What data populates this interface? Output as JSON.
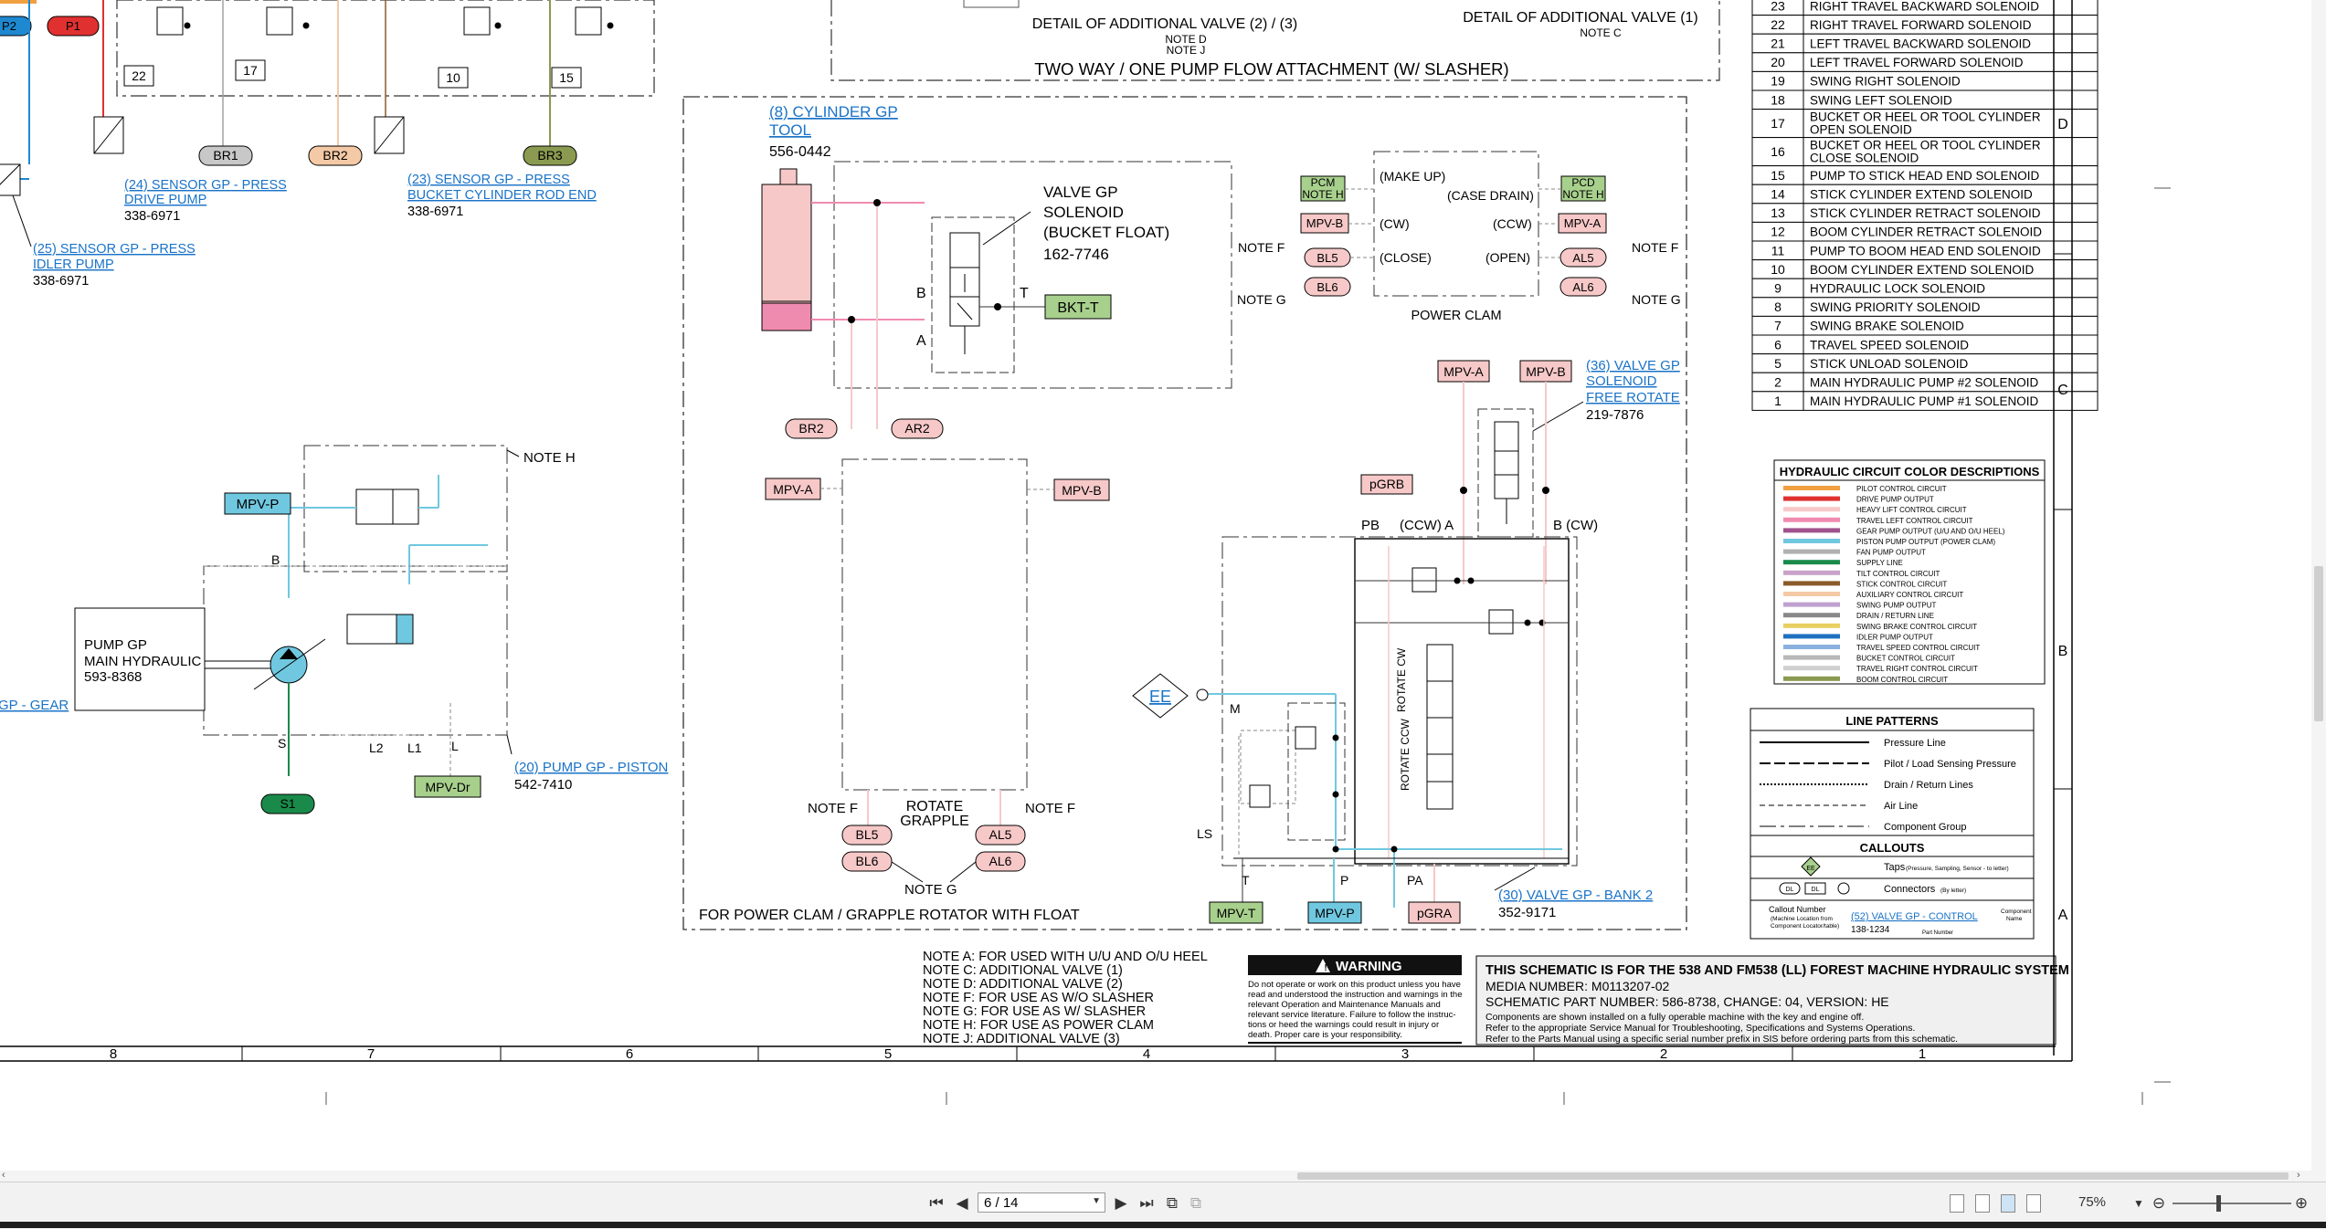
{
  "viewer": {
    "page_indicator": "6 / 14",
    "zoom": "75%"
  },
  "top_tags": {
    "p2": "P2",
    "p1": "P1"
  },
  "detail": {
    "two_three": "DETAIL OF ADDITIONAL VALVE (2) / (3)",
    "note_d": "NOTE D",
    "note_j": "NOTE J",
    "one": "DETAIL OF ADDITIONAL VALVE (1)",
    "note_c": "NOTE C",
    "box_title": "TWO WAY / ONE PUMP FLOW  ATTACHMENT (W/ SLASHER)",
    "valve_nums": [
      "22",
      "17",
      "10",
      "15"
    ]
  },
  "sensors": {
    "s24_line1": "(24) SENSOR GP - PRESS",
    "s24_line2": "DRIVE PUMP",
    "s24_part": "338-6971",
    "s23_line1": "(23) SENSOR GP - PRESS",
    "s23_line2": "BUCKET CYLINDER ROD END",
    "s23_part": "338-6971",
    "s25_line1": "(25) SENSOR GP - PRESS",
    "s25_line2": "IDLER PUMP",
    "s25_part": "338-6971",
    "br1": "BR1",
    "br2": "BR2",
    "br3": "BR3"
  },
  "pump": {
    "mpv_p": "MPV-P",
    "note_h": "NOTE H",
    "label_l1": "PUMP GP",
    "label_l2": "MAIN HYDRAULIC",
    "label_part": "593-8368",
    "port_b": "B",
    "port_s": "S",
    "port_l2": "L2",
    "port_l1": "L1",
    "port_l": "L",
    "s1": "S1",
    "mpv_dr": "MPV-Dr",
    "gear_link": "GP - GEAR",
    "piston_link": "(20) PUMP GP - PISTON",
    "piston_part": "542-7410"
  },
  "attachment": {
    "cyl_link_l1": "(8) CYLINDER GP",
    "cyl_link_l2": "TOOL",
    "cyl_part": "556-0442",
    "valve_l1": "VALVE GP",
    "valve_l2": "SOLENOID",
    "valve_l3": "(BUCKET FLOAT)",
    "valve_part": "162-7746",
    "port_b": "B",
    "port_a": "A",
    "port_t": "T",
    "bkt_t": "BKT-T",
    "br2": "BR2",
    "ar2": "AR2",
    "mpv_a": "MPV-A",
    "mpv_b": "MPV-B",
    "rotate_l1": "ROTATE",
    "rotate_l2": "GRAPPLE",
    "note_f_left": "NOTE F",
    "note_f_right": "NOTE F",
    "note_g": "NOTE G",
    "bl5": "BL5",
    "bl6": "BL6",
    "al5": "AL5",
    "al6": "AL6",
    "footer": "FOR POWER CLAM / GRAPPLE ROTATOR WITH FLOAT"
  },
  "clam": {
    "pcm_l1": "PCM",
    "pcm_l2": "NOTE H",
    "pcd_l1": "PCD",
    "pcd_l2": "NOTE H",
    "make_up": "(MAKE UP)",
    "case_drain": "(CASE DRAIN)",
    "cw": "(CW)",
    "ccw": "(CCW)",
    "close": "(CLOSE)",
    "open": "(OPEN)",
    "mpv_b": "MPV-B",
    "mpv_a": "MPV-A",
    "bl5": "BL5",
    "bl6": "BL6",
    "al5": "AL5",
    "al6": "AL6",
    "note_f_l": "NOTE F",
    "note_g_l": "NOTE G",
    "note_f_r": "NOTE F",
    "note_g_r": "NOTE G",
    "title": "POWER CLAM"
  },
  "free_rotate": {
    "mpv_a": "MPV-A",
    "mpv_b": "MPV-B",
    "link_l1": "(36) VALVE GP",
    "link_l2": "SOLENOID",
    "link_l3": "FREE ROTATE",
    "part": "219-7876",
    "pgrb": "pGRB",
    "pb": "PB",
    "ccw_a": "(CCW) A",
    "b_cw": "B (CW)",
    "ee": "EE",
    "m": "M",
    "ls": "LS",
    "t": "T",
    "p": "P",
    "pa": "PA",
    "rotate_cw": "ROTATE CW",
    "rotate_ccw": "ROTATE CCW",
    "mpv_t": "MPV-T",
    "mpv_p": "MPV-P",
    "pgra": "pGRA",
    "bank_link": "(30) VALVE GP - BANK 2",
    "bank_part": "352-9171"
  },
  "notes": [
    "NOTE A: FOR USED WITH U/U AND O/U HEEL",
    "NOTE C: ADDITIONAL VALVE (1)",
    "NOTE D: ADDITIONAL VALVE (2)",
    "NOTE F: FOR USE AS W/O SLASHER",
    "NOTE G: FOR USE AS W/ SLASHER",
    "NOTE H: FOR USE AS POWER CLAM",
    "NOTE J: ADDITIONAL VALVE (3)"
  ],
  "warning": {
    "title": "WARNING",
    "body": [
      "Do not operate or work on this product unless you have",
      "read and understood the instruction and warnings in the",
      "relevant Operation and Maintenance Manuals and",
      "relevant service literature. Failure to follow the instruc-",
      "tions or heed the warnings could result in injury or",
      "death. Proper care is your responsibility."
    ]
  },
  "title_block": {
    "line1": "THIS SCHEMATIC IS FOR THE 538 AND FM538 (LL) FOREST MACHINE HYDRAULIC SYSTEM",
    "line2": "MEDIA NUMBER: M0113207-02",
    "line3": "SCHEMATIC PART NUMBER: 586-8738, CHANGE: 04, VERSION: HE",
    "line4": "Components are shown installed on a fully operable machine with the key and engine off.",
    "line5": "Refer to the appropriate Service Manual for Troubleshooting, Specifications and Systems Operations.",
    "line6": "Refer to the Parts Manual using a specific serial number prefix in SIS before ordering parts from this schematic."
  },
  "solenoid_table": {
    "rows": [
      {
        "num": "23",
        "desc": "RIGHT TRAVEL BACKWARD SOLENOID"
      },
      {
        "num": "22",
        "desc": "RIGHT TRAVEL FORWARD SOLENOID"
      },
      {
        "num": "21",
        "desc": "LEFT TRAVEL BACKWARD SOLENOID"
      },
      {
        "num": "20",
        "desc": "LEFT TRAVEL FORWARD SOLENOID"
      },
      {
        "num": "19",
        "desc": "SWING RIGHT SOLENOID"
      },
      {
        "num": "18",
        "desc": "SWING LEFT SOLENOID"
      },
      {
        "num": "17",
        "desc": "BUCKET OR HEEL OR TOOL CYLINDER|OPEN SOLENOID"
      },
      {
        "num": "16",
        "desc": "BUCKET OR HEEL OR TOOL CYLINDER|CLOSE SOLENOID"
      },
      {
        "num": "15",
        "desc": "PUMP TO STICK HEAD END SOLENOID"
      },
      {
        "num": "14",
        "desc": "STICK CYLINDER EXTEND SOLENOID"
      },
      {
        "num": "13",
        "desc": "STICK CYLINDER RETRACT SOLENOID"
      },
      {
        "num": "12",
        "desc": "BOOM CYLINDER RETRACT SOLENOID"
      },
      {
        "num": "11",
        "desc": "PUMP TO BOOM HEAD END SOLENOID"
      },
      {
        "num": "10",
        "desc": "BOOM CYLINDER EXTEND SOLENOID"
      },
      {
        "num": "9",
        "desc": "HYDRAULIC LOCK SOLENOID"
      },
      {
        "num": "8",
        "desc": "SWING PRIORITY SOLENOID"
      },
      {
        "num": "7",
        "desc": "SWING BRAKE SOLENOID"
      },
      {
        "num": "6",
        "desc": "TRAVEL SPEED SOLENOID"
      },
      {
        "num": "5",
        "desc": "STICK UNLOAD SOLENOID"
      },
      {
        "num": "2",
        "desc": "MAIN HYDRAULIC PUMP #2 SOLENOID"
      },
      {
        "num": "1",
        "desc": "MAIN HYDRAULIC PUMP #1 SOLENOID"
      }
    ]
  },
  "color_legend": {
    "title": "HYDRAULIC CIRCUIT COLOR DESCRIPTIONS",
    "items": [
      {
        "color": "#f0a040",
        "label": "PILOT CONTROL CIRCUIT"
      },
      {
        "color": "#e03030",
        "label": "DRIVE PUMP OUTPUT"
      },
      {
        "color": "#f7c8c8",
        "label": "HEAVY LIFT CONTROL CIRCUIT"
      },
      {
        "color": "#f08bb0",
        "label": "TRAVEL LEFT CONTROL CIRCUIT"
      },
      {
        "color": "#a0528c",
        "label": "GEAR PUMP OUTPUT (U/U AND O/U HEEL)"
      },
      {
        "color": "#70c8e0",
        "label": "PISTON PUMP OUTPUT (POWER CLAM)"
      },
      {
        "color": "#b0b0b0",
        "label": "FAN PUMP OUTPUT"
      },
      {
        "color": "#1a8a4a",
        "label": "SUPPLY LINE"
      },
      {
        "color": "#c8a2c8",
        "label": "TILT CONTROL CIRCUIT"
      },
      {
        "color": "#8b5a2b",
        "label": "STICK CONTROL CIRCUIT"
      },
      {
        "color": "#f4c9a5",
        "label": "AUXILIARY CONTROL CIRCUIT"
      },
      {
        "color": "#c0a0d0",
        "label": "SWING PUMP OUTPUT"
      },
      {
        "color": "#888888",
        "label": "DRAIN / RETURN LINE"
      },
      {
        "color": "#e8d060",
        "label": "SWING BRAKE CONTROL CIRCUIT"
      },
      {
        "color": "#2070c0",
        "label": "IDLER PUMP OUTPUT"
      },
      {
        "color": "#8ab0e0",
        "label": "TRAVEL SPEED CONTROL CIRCUIT"
      },
      {
        "color": "#b8b8b8",
        "label": "BUCKET CONTROL CIRCUIT"
      },
      {
        "color": "#d0d0d0",
        "label": "TRAVEL RIGHT CONTROL CIRCUIT"
      },
      {
        "color": "#8a9a50",
        "label": "BOOM CONTROL CIRCUIT"
      }
    ]
  },
  "line_patterns": {
    "title": "LINE PATTERNS",
    "items": [
      "Pressure Line",
      "Pilot / Load Sensing Pressure",
      "Drain / Return Lines",
      "Air Line",
      "Component Group"
    ]
  },
  "callouts": {
    "title": "CALLOUTS",
    "taps_label": "Taps",
    "taps_sub": "(Pressure, Sampling, Sensor - to letter)",
    "connectors_label": "Connectors",
    "connectors_sub": "(By letter)",
    "tap_example": "EE",
    "conn_a": "DL",
    "conn_b": "DL",
    "callout_number": "Callout Number",
    "machine_loc": "(Machine Location from",
    "comp_loc": "Component Locator/table)",
    "example_link": "(52) VALVE GP - CONTROL",
    "component_name_l1": "Component",
    "component_name_l2": "Name",
    "example_part": "138-1234",
    "part_number": "Part Number"
  },
  "grid": {
    "bottom": [
      "8",
      "7",
      "6",
      "5",
      "4",
      "3",
      "2",
      "1"
    ],
    "right": [
      "D",
      "C",
      "B",
      "A"
    ]
  }
}
